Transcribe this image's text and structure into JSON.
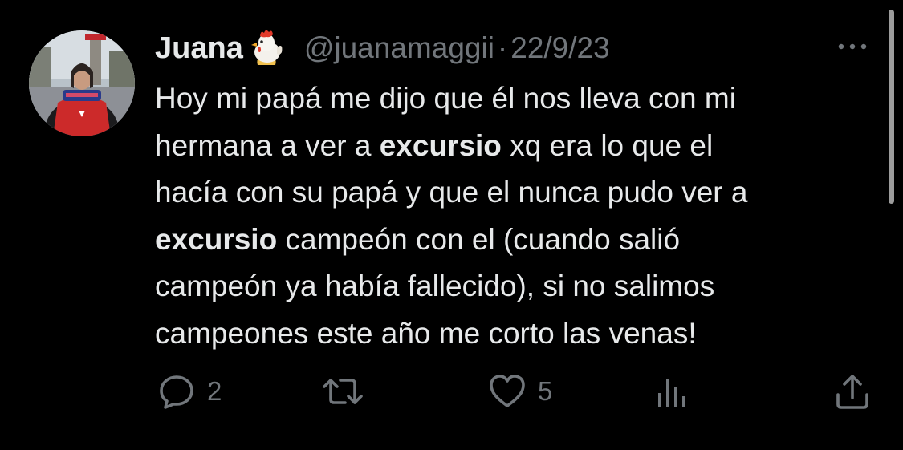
{
  "tweet": {
    "display_name": "Juana",
    "name_emoji": "rooster-emoji",
    "handle": "@juanamaggii",
    "separator": "·",
    "date": "22/9/23",
    "body": {
      "lines": [
        [
          {
            "t": "Hoy mi papá me dijo que él nos lleva con mi",
            "b": false
          }
        ],
        [
          {
            "t": "hermana a ver a ",
            "b": false
          },
          {
            "t": "excursio",
            "b": true
          },
          {
            "t": " xq era lo que el",
            "b": false
          }
        ],
        [
          {
            "t": "hacía con su papá y que el nunca pudo ver a",
            "b": false
          }
        ],
        [
          {
            "t": "excursio",
            "b": true
          },
          {
            "t": " campeón con el (cuando salió",
            "b": false
          }
        ],
        [
          {
            "t": "campeón ya había fallecido), si no salimos",
            "b": false
          }
        ],
        [
          {
            "t": "campeones este año me corto las venas!",
            "b": false
          }
        ]
      ]
    },
    "actions": {
      "reply_count": "2",
      "retweet_count": "",
      "like_count": "5",
      "views_count": ""
    }
  },
  "icons": {
    "more": "more-horizontal-icon",
    "reply": "reply-bubble-icon",
    "retweet": "retweet-icon",
    "like": "heart-icon",
    "views": "views-bars-icon",
    "share": "share-upload-icon"
  },
  "colors": {
    "background": "#000000",
    "primary_text": "#e7e9ea",
    "secondary_text": "#71767b"
  }
}
